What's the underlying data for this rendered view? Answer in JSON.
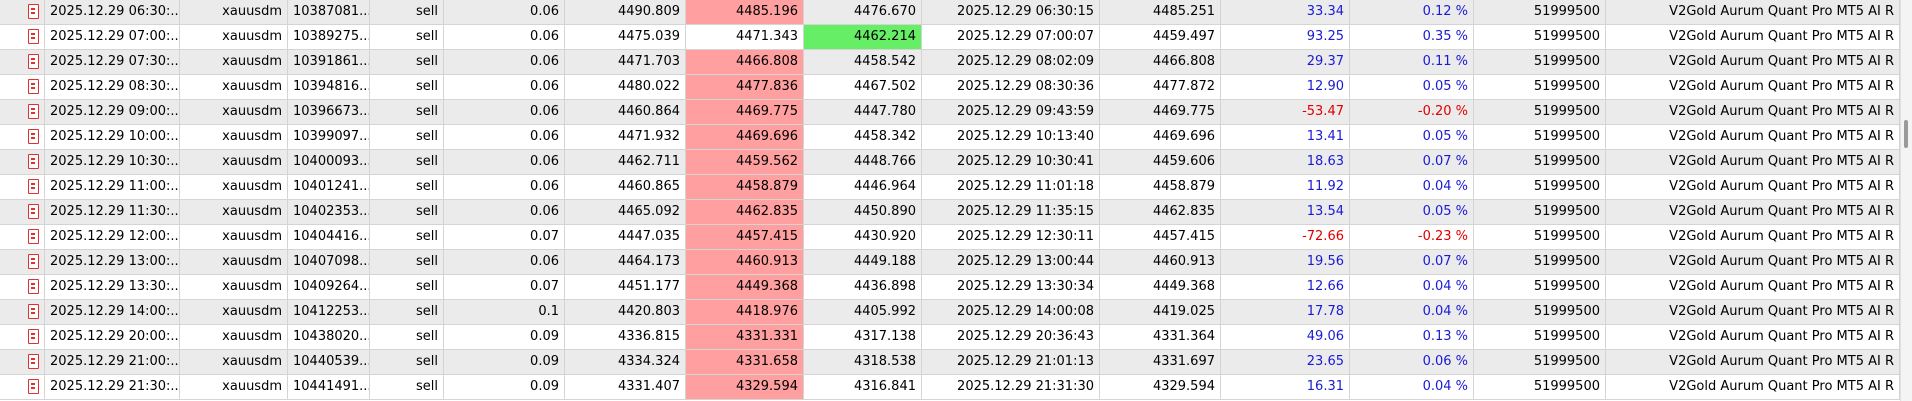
{
  "trades": [
    {
      "open_time": "2025.12.29 06:30:...",
      "symbol": "xauusdm",
      "ticket": "10387081...",
      "type": "sell",
      "volume": "0.06",
      "open_price": "4490.809",
      "sl": "4485.196",
      "tp": "4476.670",
      "close_time": "2025.12.29 06:30:15",
      "close_price": "4485.251",
      "profit": "33.34",
      "change": "0.12 %",
      "magic": "51999500",
      "comment": "V2Gold Aurum Quant Pro MT5 AI R",
      "sl_hl": "red",
      "tp_hl": "",
      "profit_sign": "pos"
    },
    {
      "open_time": "2025.12.29 07:00:...",
      "symbol": "xauusdm",
      "ticket": "10389275...",
      "type": "sell",
      "volume": "0.06",
      "open_price": "4475.039",
      "sl": "4471.343",
      "tp": "4462.214",
      "close_time": "2025.12.29 07:00:07",
      "close_price": "4459.497",
      "profit": "93.25",
      "change": "0.35 %",
      "magic": "51999500",
      "comment": "V2Gold Aurum Quant Pro MT5 AI R",
      "sl_hl": "",
      "tp_hl": "green",
      "profit_sign": "pos"
    },
    {
      "open_time": "2025.12.29 07:30:...",
      "symbol": "xauusdm",
      "ticket": "10391861...",
      "type": "sell",
      "volume": "0.06",
      "open_price": "4471.703",
      "sl": "4466.808",
      "tp": "4458.542",
      "close_time": "2025.12.29 08:02:09",
      "close_price": "4466.808",
      "profit": "29.37",
      "change": "0.11 %",
      "magic": "51999500",
      "comment": "V2Gold Aurum Quant Pro MT5 AI R",
      "sl_hl": "red",
      "tp_hl": "",
      "profit_sign": "pos"
    },
    {
      "open_time": "2025.12.29 08:30:...",
      "symbol": "xauusdm",
      "ticket": "10394816...",
      "type": "sell",
      "volume": "0.06",
      "open_price": "4480.022",
      "sl": "4477.836",
      "tp": "4467.502",
      "close_time": "2025.12.29 08:30:36",
      "close_price": "4477.872",
      "profit": "12.90",
      "change": "0.05 %",
      "magic": "51999500",
      "comment": "V2Gold Aurum Quant Pro MT5 AI R",
      "sl_hl": "red",
      "tp_hl": "",
      "profit_sign": "pos"
    },
    {
      "open_time": "2025.12.29 09:00:...",
      "symbol": "xauusdm",
      "ticket": "10396673...",
      "type": "sell",
      "volume": "0.06",
      "open_price": "4460.864",
      "sl": "4469.775",
      "tp": "4447.780",
      "close_time": "2025.12.29 09:43:59",
      "close_price": "4469.775",
      "profit": "-53.47",
      "change": "-0.20 %",
      "magic": "51999500",
      "comment": "V2Gold Aurum Quant Pro MT5 AI R",
      "sl_hl": "red",
      "tp_hl": "",
      "profit_sign": "neg"
    },
    {
      "open_time": "2025.12.29 10:00:...",
      "symbol": "xauusdm",
      "ticket": "10399097...",
      "type": "sell",
      "volume": "0.06",
      "open_price": "4471.932",
      "sl": "4469.696",
      "tp": "4458.342",
      "close_time": "2025.12.29 10:13:40",
      "close_price": "4469.696",
      "profit": "13.41",
      "change": "0.05 %",
      "magic": "51999500",
      "comment": "V2Gold Aurum Quant Pro MT5 AI R",
      "sl_hl": "red",
      "tp_hl": "",
      "profit_sign": "pos"
    },
    {
      "open_time": "2025.12.29 10:30:...",
      "symbol": "xauusdm",
      "ticket": "10400093...",
      "type": "sell",
      "volume": "0.06",
      "open_price": "4462.711",
      "sl": "4459.562",
      "tp": "4448.766",
      "close_time": "2025.12.29 10:30:41",
      "close_price": "4459.606",
      "profit": "18.63",
      "change": "0.07 %",
      "magic": "51999500",
      "comment": "V2Gold Aurum Quant Pro MT5 AI R",
      "sl_hl": "red",
      "tp_hl": "",
      "profit_sign": "pos"
    },
    {
      "open_time": "2025.12.29 11:00:...",
      "symbol": "xauusdm",
      "ticket": "10401241...",
      "type": "sell",
      "volume": "0.06",
      "open_price": "4460.865",
      "sl": "4458.879",
      "tp": "4446.964",
      "close_time": "2025.12.29 11:01:18",
      "close_price": "4458.879",
      "profit": "11.92",
      "change": "0.04 %",
      "magic": "51999500",
      "comment": "V2Gold Aurum Quant Pro MT5 AI R",
      "sl_hl": "red",
      "tp_hl": "",
      "profit_sign": "pos"
    },
    {
      "open_time": "2025.12.29 11:30:...",
      "symbol": "xauusdm",
      "ticket": "10402353...",
      "type": "sell",
      "volume": "0.06",
      "open_price": "4465.092",
      "sl": "4462.835",
      "tp": "4450.890",
      "close_time": "2025.12.29 11:35:15",
      "close_price": "4462.835",
      "profit": "13.54",
      "change": "0.05 %",
      "magic": "51999500",
      "comment": "V2Gold Aurum Quant Pro MT5 AI R",
      "sl_hl": "red",
      "tp_hl": "",
      "profit_sign": "pos"
    },
    {
      "open_time": "2025.12.29 12:00:...",
      "symbol": "xauusdm",
      "ticket": "10404416...",
      "type": "sell",
      "volume": "0.07",
      "open_price": "4447.035",
      "sl": "4457.415",
      "tp": "4430.920",
      "close_time": "2025.12.29 12:30:11",
      "close_price": "4457.415",
      "profit": "-72.66",
      "change": "-0.23 %",
      "magic": "51999500",
      "comment": "V2Gold Aurum Quant Pro MT5 AI R",
      "sl_hl": "red",
      "tp_hl": "",
      "profit_sign": "neg"
    },
    {
      "open_time": "2025.12.29 13:00:...",
      "symbol": "xauusdm",
      "ticket": "10407098...",
      "type": "sell",
      "volume": "0.06",
      "open_price": "4464.173",
      "sl": "4460.913",
      "tp": "4449.188",
      "close_time": "2025.12.29 13:00:44",
      "close_price": "4460.913",
      "profit": "19.56",
      "change": "0.07 %",
      "magic": "51999500",
      "comment": "V2Gold Aurum Quant Pro MT5 AI R",
      "sl_hl": "red",
      "tp_hl": "",
      "profit_sign": "pos"
    },
    {
      "open_time": "2025.12.29 13:30:...",
      "symbol": "xauusdm",
      "ticket": "10409264...",
      "type": "sell",
      "volume": "0.07",
      "open_price": "4451.177",
      "sl": "4449.368",
      "tp": "4436.898",
      "close_time": "2025.12.29 13:30:34",
      "close_price": "4449.368",
      "profit": "12.66",
      "change": "0.04 %",
      "magic": "51999500",
      "comment": "V2Gold Aurum Quant Pro MT5 AI R",
      "sl_hl": "red",
      "tp_hl": "",
      "profit_sign": "pos"
    },
    {
      "open_time": "2025.12.29 14:00:...",
      "symbol": "xauusdm",
      "ticket": "10412253...",
      "type": "sell",
      "volume": "0.1",
      "open_price": "4420.803",
      "sl": "4418.976",
      "tp": "4405.992",
      "close_time": "2025.12.29 14:00:08",
      "close_price": "4419.025",
      "profit": "17.78",
      "change": "0.04 %",
      "magic": "51999500",
      "comment": "V2Gold Aurum Quant Pro MT5 AI R",
      "sl_hl": "red",
      "tp_hl": "",
      "profit_sign": "pos"
    },
    {
      "open_time": "2025.12.29 20:00:...",
      "symbol": "xauusdm",
      "ticket": "10438020...",
      "type": "sell",
      "volume": "0.09",
      "open_price": "4336.815",
      "sl": "4331.331",
      "tp": "4317.138",
      "close_time": "2025.12.29 20:36:43",
      "close_price": "4331.364",
      "profit": "49.06",
      "change": "0.13 %",
      "magic": "51999500",
      "comment": "V2Gold Aurum Quant Pro MT5 AI R",
      "sl_hl": "red",
      "tp_hl": "",
      "profit_sign": "pos"
    },
    {
      "open_time": "2025.12.29 21:00:...",
      "symbol": "xauusdm",
      "ticket": "10440539...",
      "type": "sell",
      "volume": "0.09",
      "open_price": "4334.324",
      "sl": "4331.658",
      "tp": "4318.538",
      "close_time": "2025.12.29 21:01:13",
      "close_price": "4331.697",
      "profit": "23.65",
      "change": "0.06 %",
      "magic": "51999500",
      "comment": "V2Gold Aurum Quant Pro MT5 AI R",
      "sl_hl": "red",
      "tp_hl": "",
      "profit_sign": "pos"
    },
    {
      "open_time": "2025.12.29 21:30:...",
      "symbol": "xauusdm",
      "ticket": "10441491...",
      "type": "sell",
      "volume": "0.09",
      "open_price": "4331.407",
      "sl": "4329.594",
      "tp": "4316.841",
      "close_time": "2025.12.29 21:31:30",
      "close_price": "4329.594",
      "profit": "16.31",
      "change": "0.04 %",
      "magic": "51999500",
      "comment": "V2Gold Aurum Quant Pro MT5 AI R",
      "sl_hl": "red",
      "tp_hl": "",
      "profit_sign": "pos"
    }
  ],
  "icon": "document-icon",
  "colors": {
    "row_odd": "#ebebeb",
    "row_even": "#ffffff",
    "stop_loss_highlight": "#ff9f9f",
    "take_profit_highlight": "#66ee66",
    "profit_positive": "#1a1ad6",
    "profit_negative": "#e00000",
    "icon_red": "#e03030"
  }
}
